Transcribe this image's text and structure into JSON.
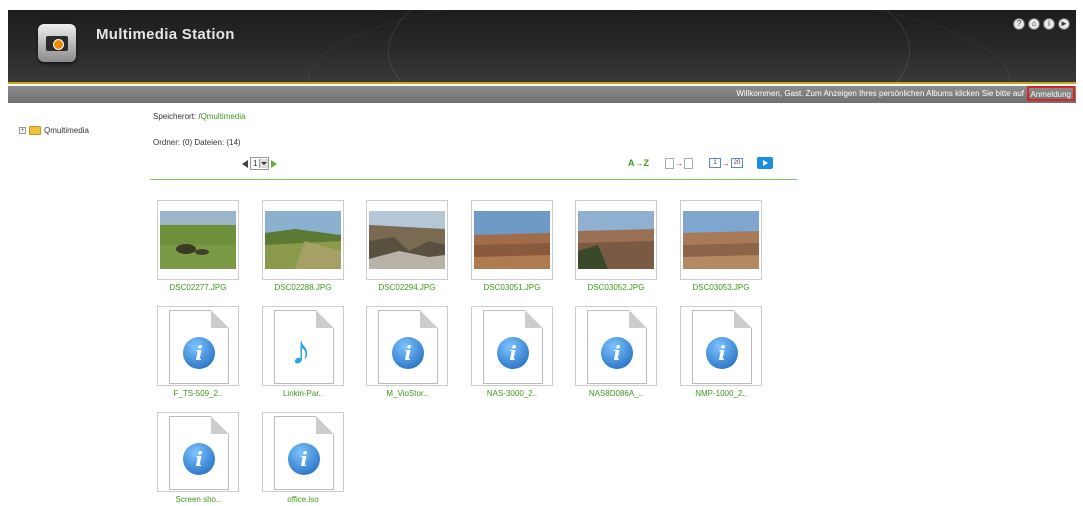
{
  "header": {
    "app_title": "Multimedia Station",
    "logo_icon": "camera-icon",
    "top_icons": [
      "help-icon",
      "home-icon",
      "info-icon",
      "logout-icon"
    ]
  },
  "welcome_bar": {
    "text": "Willkommen, Gast. Zum Anzeigen Ihres persönlichen Albums klicken Sie bitte auf",
    "login_label": "Anmeldung"
  },
  "tree": {
    "root_label": "Qmultimedia"
  },
  "location": {
    "prefix": "Speicherort: /",
    "folder": "Qmultimedia"
  },
  "counts": "Ordner: (0) Dateien: (14)",
  "pager": {
    "current_page": "1"
  },
  "toolbar": {
    "sort_label": "A→Z"
  },
  "colors": {
    "accent_green": "#3b9a1b",
    "header_dark": "#1c1c1c",
    "highlight_red": "#d22222"
  },
  "files": [
    {
      "name": "DSC02277.JPG",
      "type": "image"
    },
    {
      "name": "DSC02288.JPG",
      "type": "image"
    },
    {
      "name": "DSC02294.JPG",
      "type": "image"
    },
    {
      "name": "DSC03051.JPG",
      "type": "image"
    },
    {
      "name": "DSC03052.JPG",
      "type": "image"
    },
    {
      "name": "DSC03053.JPG",
      "type": "image"
    },
    {
      "name": "F_TS-509_2..",
      "type": "info"
    },
    {
      "name": "Linkin-Par..",
      "type": "music"
    },
    {
      "name": "M_VioStor..",
      "type": "info"
    },
    {
      "name": "NAS-3000_2..",
      "type": "info"
    },
    {
      "name": "NAS8D086A_..",
      "type": "info"
    },
    {
      "name": "NMP-1000_2..",
      "type": "info"
    },
    {
      "name": "Screen sho..",
      "type": "info"
    },
    {
      "name": "office.iso",
      "type": "info"
    }
  ]
}
